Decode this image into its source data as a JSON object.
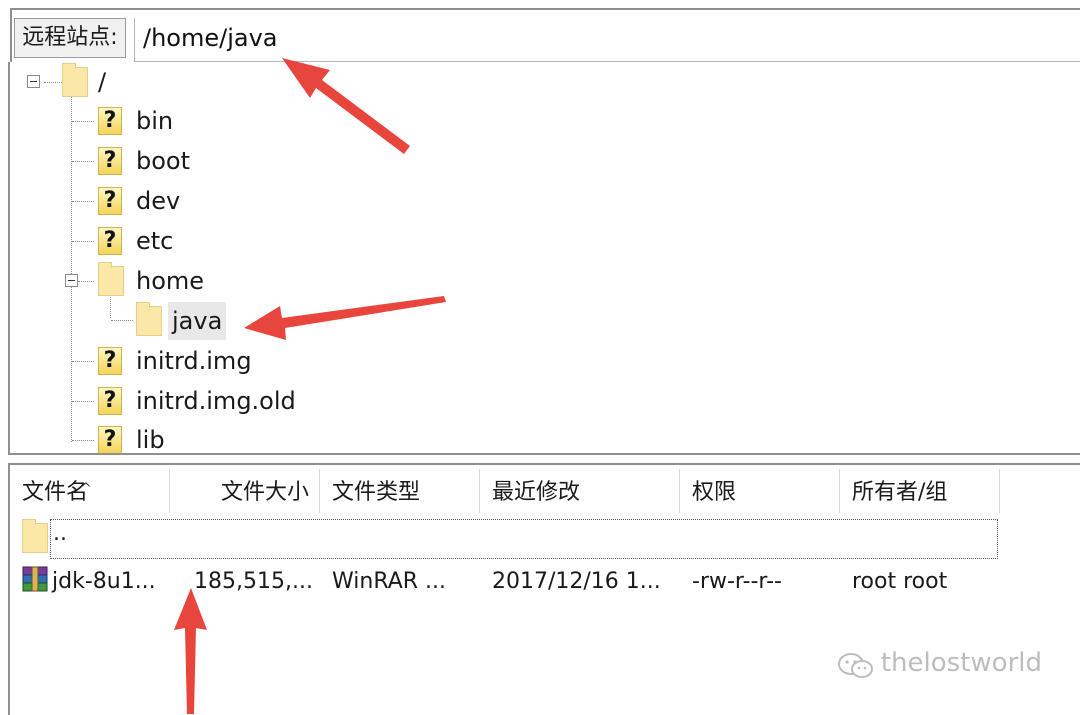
{
  "site_bar": {
    "label": "远程站点:",
    "path": "/home/java"
  },
  "tree": {
    "root": "/",
    "items": [
      "bin",
      "boot",
      "dev",
      "etc",
      "home",
      "java",
      "initrd.img",
      "initrd.img.old",
      "lib"
    ]
  },
  "file_list": {
    "headers": [
      "文件名",
      "文件大小",
      "文件类型",
      "最近修改",
      "权限",
      "所有者/组"
    ],
    "parent_row": "..",
    "rows": [
      {
        "name": "jdk-8u1...",
        "size": "185,515,...",
        "type": "WinRAR ...",
        "modified": "2017/12/16 1...",
        "permissions": "-rw-r--r--",
        "owner": "root root"
      }
    ]
  },
  "watermark": "thelostworld",
  "colors": {
    "arrow": "#e8463c",
    "folder": "#fbe7a7",
    "unknown_icon": "#f4d45a"
  }
}
